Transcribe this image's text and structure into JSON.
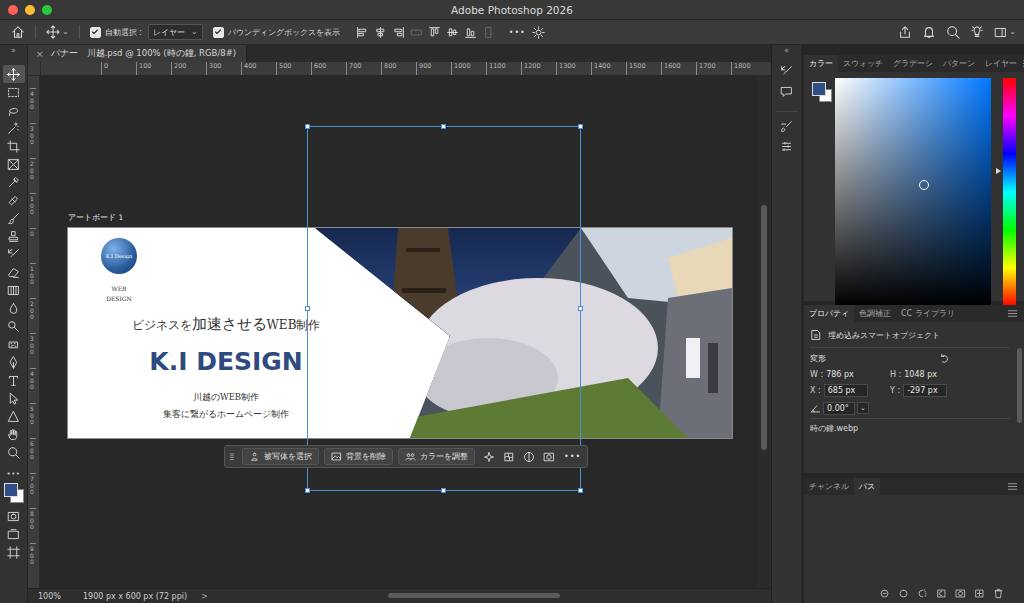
{
  "window": {
    "title": "Adobe Photoshop 2026",
    "lights": [
      {
        "color": "#ff5f57"
      },
      {
        "color": "#febc2e"
      },
      {
        "color": "#28c840"
      }
    ]
  },
  "options_bar": {
    "tool_arrow": "⌄",
    "auto_select": {
      "label": "自動選択 :",
      "checked": true
    },
    "target": {
      "value": "レイヤー",
      "arrow": "⌄"
    },
    "bounding_box": {
      "label": "バウンディングボックスを表示",
      "checked": true
    },
    "align": [
      {
        "kind": "align-left",
        "disabled": false
      },
      {
        "kind": "align-hcenter",
        "disabled": false
      },
      {
        "kind": "align-right",
        "disabled": false
      },
      {
        "kind": "distribute-h",
        "disabled": true
      },
      {
        "kind": "align-top",
        "disabled": false
      },
      {
        "kind": "align-vcenter",
        "disabled": false
      },
      {
        "kind": "align-bottom",
        "disabled": false
      },
      {
        "kind": "distribute-v",
        "disabled": true
      }
    ],
    "more": "•••",
    "workspace_arrow": "⌄"
  },
  "toolbar": {
    "collapse": "»",
    "tools": [
      {
        "kind": "move",
        "selected": true
      },
      {
        "kind": "marquee",
        "selected": false
      },
      {
        "kind": "lasso",
        "selected": false
      },
      {
        "kind": "magic",
        "selected": false
      },
      {
        "kind": "crop",
        "selected": false
      },
      {
        "kind": "frame",
        "selected": false
      },
      {
        "kind": "eyedropper",
        "selected": false
      },
      {
        "kind": "heal",
        "selected": false
      },
      {
        "kind": "brush",
        "selected": false
      },
      {
        "kind": "stamp",
        "selected": false
      },
      {
        "kind": "history",
        "selected": false
      },
      {
        "kind": "eraser",
        "selected": false
      },
      {
        "kind": "gradient",
        "selected": false
      },
      {
        "kind": "blur",
        "selected": false
      },
      {
        "kind": "dodge",
        "selected": false
      },
      {
        "kind": "sponge",
        "selected": false
      },
      {
        "kind": "pen",
        "selected": false
      },
      {
        "kind": "type",
        "selected": false
      },
      {
        "kind": "select",
        "selected": false
      },
      {
        "kind": "shape",
        "selected": false
      },
      {
        "kind": "hand",
        "selected": false
      },
      {
        "kind": "zoom",
        "selected": false
      }
    ],
    "more": "•••",
    "foreground": "#2f4f86",
    "background": "#ffffff",
    "bottom_tools": [
      {
        "kind": "quickmask"
      },
      {
        "kind": "screen"
      },
      {
        "kind": "artboard"
      }
    ]
  },
  "document_tab": {
    "close": "×",
    "title": "バナー　川越.psd @ 100% (時の鐘, RGB/8#)"
  },
  "rulers": {
    "horizontal": [
      "0",
      "100",
      "200",
      "300",
      "400",
      "500",
      "600",
      "700",
      "800",
      "900",
      "1000",
      "1100",
      "1200",
      "1300",
      "1400",
      "1500",
      "1600",
      "1700",
      "1800"
    ],
    "vertical": [
      "400",
      "300",
      "200",
      "100",
      "0",
      "100",
      "200",
      "300",
      "400",
      "500",
      "600",
      "700",
      "800",
      "900"
    ]
  },
  "canvas": {
    "artboard_label": "アートボード 1",
    "artboard": {
      "logo": "K.I Design",
      "logo_sub": [
        "WEB",
        "DESIGN"
      ],
      "headline": [
        {
          "text": "ビジネスを",
          "emphasis": false
        },
        {
          "text": "加速させる",
          "emphasis": true
        },
        {
          "text": "WEB制作",
          "emphasis": false
        }
      ],
      "brand": "K.I DESIGN",
      "lines": [
        "川越のWEB制作",
        "集客に繋がるホームページ制作"
      ]
    },
    "transform_selected": true
  },
  "task_bar": {
    "buttons": [
      {
        "label": "被写体を選択",
        "kind": "person"
      },
      {
        "label": "背景を削除",
        "kind": "image"
      },
      {
        "label": "カラーを調整",
        "kind": "people"
      }
    ],
    "tools": [
      {
        "kind": "sparkle"
      },
      {
        "kind": "warp"
      },
      {
        "kind": "contrast"
      },
      {
        "kind": "mask"
      }
    ],
    "more": "•••"
  },
  "status_bar": {
    "zoom": "100%",
    "size": "1900 px x 600 px (72 ppi)",
    "arrow": ">"
  },
  "dock": {
    "collapse": "«",
    "icons": [
      {
        "kind": "history"
      },
      {
        "kind": "comment"
      },
      {
        "kind": "brushes"
      },
      {
        "kind": "adjust"
      }
    ]
  },
  "color_panel": {
    "tabs": [
      {
        "label": "カラー",
        "selected": true
      },
      {
        "label": "スウォッチ",
        "selected": false
      },
      {
        "label": "グラデーシ",
        "selected": false
      },
      {
        "label": "パターン",
        "selected": false
      },
      {
        "label": "レイヤー",
        "selected": false
      }
    ],
    "hue_level": 0.41,
    "saturation": 0.57,
    "brightness": 0.53
  },
  "properties_panel": {
    "tabs": [
      {
        "label": "プロパティ",
        "selected": true
      },
      {
        "label": "色調補正",
        "selected": false
      },
      {
        "label": "CC ライブラリ",
        "selected": false
      }
    ],
    "type": "埋め込みスマートオブジェクト",
    "section": "変形",
    "fields": [
      {
        "label": "W :",
        "value": "786 px",
        "kind": "text"
      },
      {
        "label": "H :",
        "value": "1048 px",
        "kind": "text"
      },
      {
        "label": "X :",
        "value": "685 px",
        "kind": "input"
      },
      {
        "label": "Y :",
        "value": "-297 px",
        "kind": "input"
      }
    ],
    "angle": {
      "value": "0.00°",
      "arrow": "⌄"
    },
    "file": "時の鐘.webp"
  },
  "channels_panel": {
    "tabs": [
      {
        "label": "チャンネル",
        "selected": false
      },
      {
        "label": "パス",
        "selected": true
      }
    ],
    "footer": [
      {
        "kind": "fill"
      },
      {
        "kind": "stroke"
      },
      {
        "kind": "load"
      },
      {
        "kind": "work"
      },
      {
        "kind": "mask"
      },
      {
        "kind": "new"
      },
      {
        "kind": "delete"
      }
    ]
  }
}
